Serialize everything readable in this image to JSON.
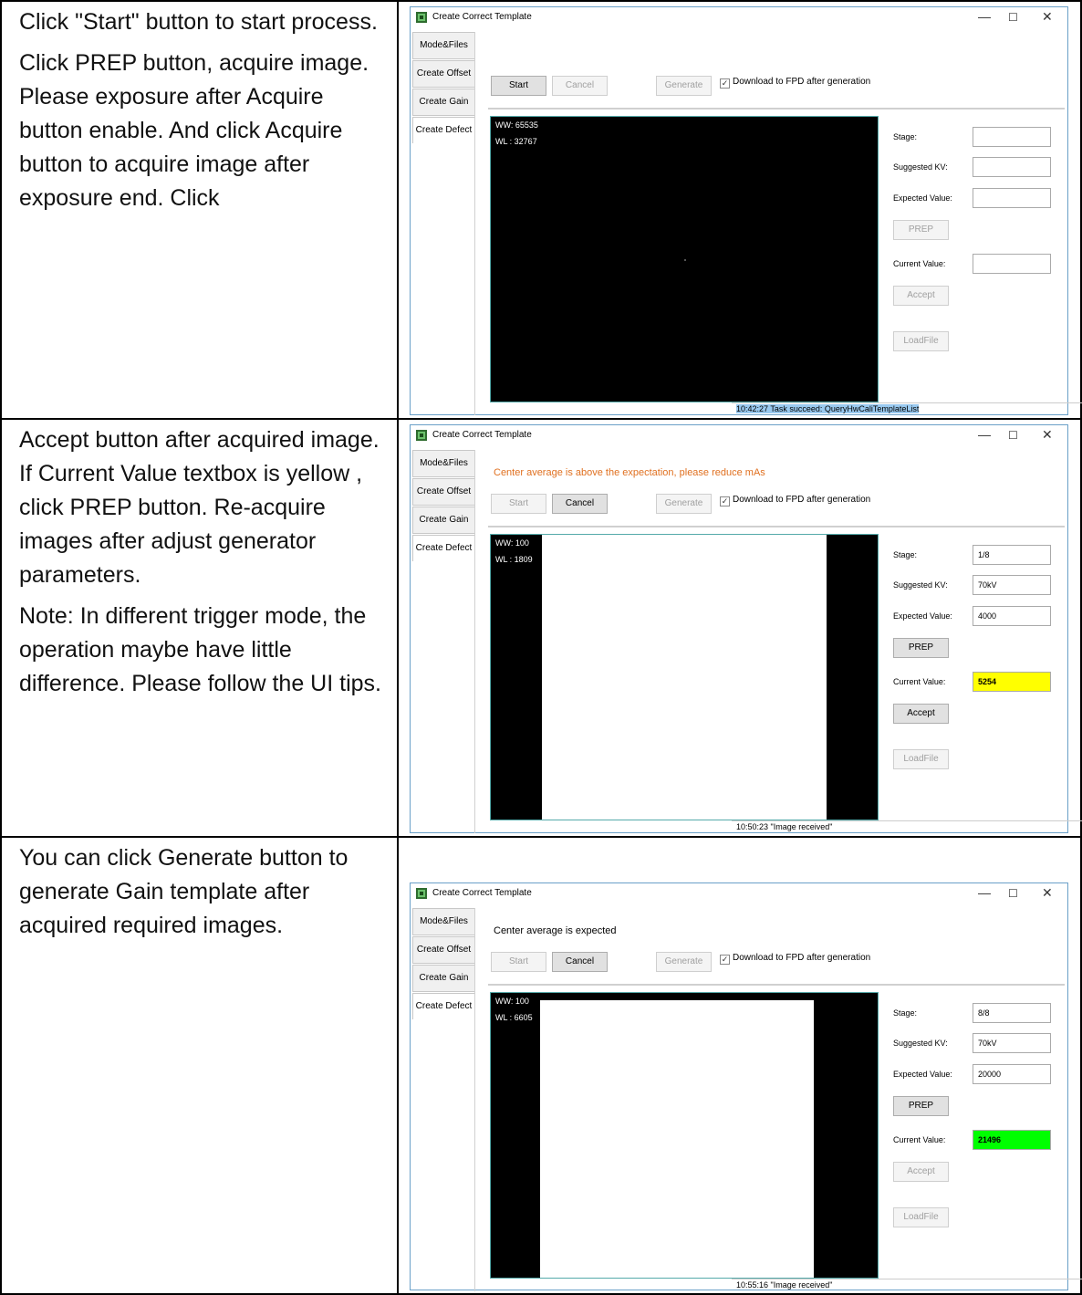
{
  "instructions": [
    [
      "Click \"Start\" button to start process.",
      "Click PREP button, acquire image. Please exposure after Acquire button enable. And click Acquire button to acquire image after exposure end. Click"
    ],
    [
      "Accept button after acquired image. If Current Value textbox is yellow , click PREP button. Re-acquire images after adjust generator parameters.",
      "Note: In different trigger mode, the operation maybe have little difference. Please follow the UI tips."
    ],
    [
      "You can click Generate button to generate Gain template after acquired required images."
    ]
  ],
  "windows": [
    {
      "title": "Create Correct Template",
      "tabs": [
        "Mode&Files",
        "Create Offset",
        "Create Gain",
        "Create Defect"
      ],
      "message": "",
      "buttons": {
        "start": "Start",
        "cancel": "Cancel",
        "generate": "Generate",
        "prep": "PREP",
        "accept": "Accept",
        "loadfile": "LoadFile"
      },
      "checkbox_label": "Download to FPD after generation",
      "checkbox_checked": true,
      "ww": "WW:  65535",
      "wl": "WL :  32767",
      "labels": {
        "stage": "Stage:",
        "kv": "Suggested KV:",
        "expected": "Expected Value:",
        "current": "Current Value:"
      },
      "stage": "",
      "kv": "",
      "expected": "",
      "current": "",
      "current_color": "",
      "status": "10:42:27 Task succeed: QueryHwCaliTemplateList"
    },
    {
      "title": "Create Correct Template",
      "tabs": [
        "Mode&Files",
        "Create Offset",
        "Create Gain",
        "Create Defect"
      ],
      "message": "Center average is above the expectation, please reduce mAs",
      "buttons": {
        "start": "Start",
        "cancel": "Cancel",
        "generate": "Generate",
        "prep": "PREP",
        "accept": "Accept",
        "loadfile": "LoadFile"
      },
      "checkbox_label": "Download to FPD after generation",
      "checkbox_checked": true,
      "ww": "WW:  100",
      "wl": "WL :  1809",
      "labels": {
        "stage": "Stage:",
        "kv": "Suggested KV:",
        "expected": "Expected Value:",
        "current": "Current Value:"
      },
      "stage": "1/8",
      "kv": "70kV",
      "expected": "4000",
      "current": "5254",
      "current_color": "#ffff00",
      "status": "10:50:23 \"Image received\""
    },
    {
      "title": "Create Correct Template",
      "tabs": [
        "Mode&Files",
        "Create Offset",
        "Create Gain",
        "Create Defect"
      ],
      "message": "Center average is expected",
      "buttons": {
        "start": "Start",
        "cancel": "Cancel",
        "generate": "Generate",
        "prep": "PREP",
        "accept": "Accept",
        "loadfile": "LoadFile"
      },
      "checkbox_label": "Download to FPD after generation",
      "checkbox_checked": true,
      "ww": "WW:  100",
      "wl": "WL :  6605",
      "labels": {
        "stage": "Stage:",
        "kv": "Suggested KV:",
        "expected": "Expected Value:",
        "current": "Current Value:"
      },
      "stage": "8/8",
      "kv": "70kV",
      "expected": "20000",
      "current": "21496",
      "current_color": "#00ff00",
      "status": "10:55:16 \"Image received\""
    }
  ],
  "window_controls": {
    "minimize": "—",
    "maximize": "☐",
    "close": "✕"
  },
  "checkbox_mark": "✓",
  "status_chevron": "⌄",
  "colors": {
    "warning_text": "#e07020",
    "current_yellow": "#ffff00",
    "current_green": "#00ff00",
    "status_highlight": "#99c9ef"
  }
}
